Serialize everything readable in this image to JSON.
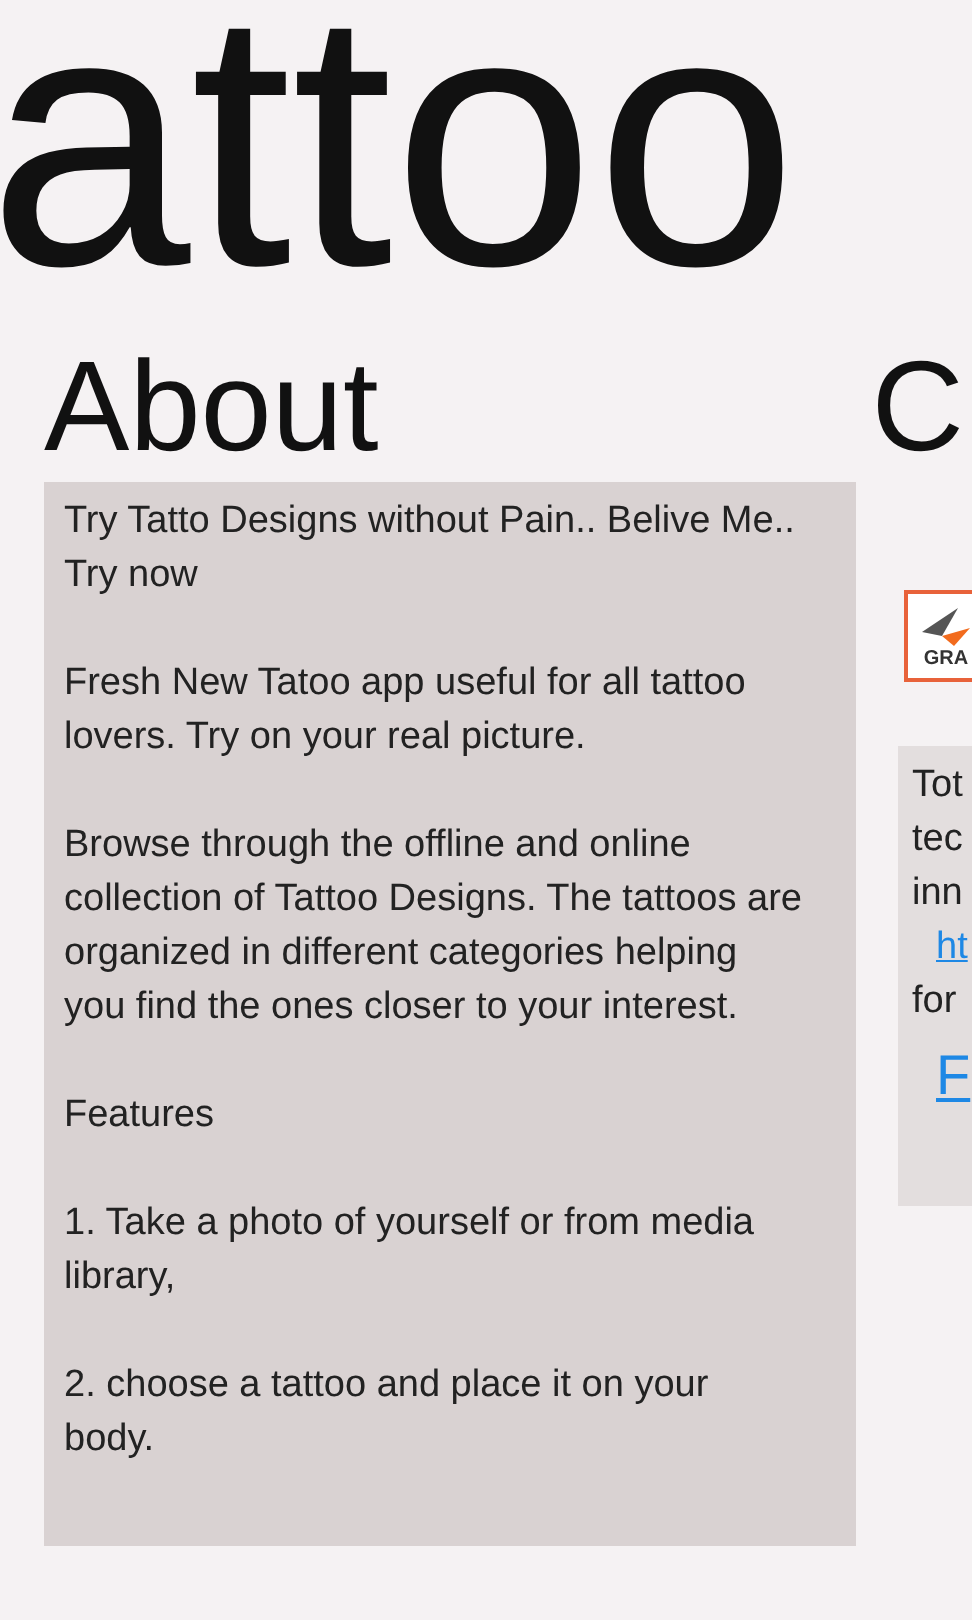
{
  "app_title": "attoo",
  "sections": [
    {
      "kind": "about",
      "header": "About",
      "paragraphs": [
        "Try Tatto Designs without Pain.. Belive Me.. Try now",
        "Fresh New Tatoo app useful for all tattoo lovers.  Try on your real picture.",
        "Browse through the offline and online collection of Tattoo Designs. The tattoos are organized in different categories helping you find the ones closer to your interest.",
        "Features",
        "1. Take a photo of yourself or from media library,",
        "2. choose a tattoo and place it on your body."
      ]
    },
    {
      "kind": "company",
      "header": "C",
      "logo_text": "GRA",
      "lines": [
        {
          "kind": "text",
          "text": "Tot"
        },
        {
          "kind": "text",
          "text": "tec"
        },
        {
          "kind": "text",
          "text": "inn"
        },
        {
          "kind": "link",
          "text": "ht"
        },
        {
          "kind": "text",
          "text": "for"
        },
        {
          "kind": "big_link",
          "text": "F"
        }
      ]
    }
  ]
}
